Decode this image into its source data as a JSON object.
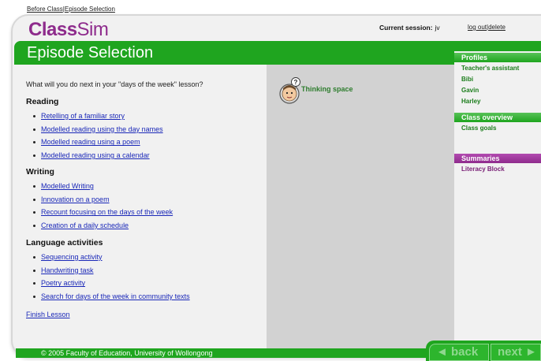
{
  "breadcrumb": {
    "item1": "Before Class",
    "separator": "|",
    "item2": "Episode Selection"
  },
  "app": {
    "logo_bold": "Class",
    "logo_light": "Sim"
  },
  "session": {
    "label": "Current session:",
    "value": "jv"
  },
  "account": {
    "logout": "log out",
    "separator": "|",
    "delete": "delete"
  },
  "page": {
    "title": "Episode Selection"
  },
  "main": {
    "prompt": "What will you do next in your \"days of the week\" lesson?",
    "sections": [
      {
        "heading": "Reading",
        "links": [
          "Retelling of a familiar story",
          "Modelled reading using the day names",
          "Modelled reading using a poem",
          "Modelled reading using a calendar"
        ]
      },
      {
        "heading": "Writing",
        "links": [
          "Modelled Writing",
          "Innovation on a poem",
          "Recount focusing on the days of the week",
          "Creation of a daily schedule"
        ]
      },
      {
        "heading": "Language activities",
        "links": [
          "Sequencing activity",
          "Handwriting task",
          "Poetry activity",
          "Search for days of the week in community texts"
        ]
      }
    ],
    "finish": "Finish Lesson"
  },
  "thinking": {
    "label": "Thinking space",
    "icon": "thinking-face-icon"
  },
  "sidebar": {
    "profiles_heading": "Profiles",
    "profiles": [
      "Teacher's assistant",
      "Bibi",
      "Gavin",
      "Harley"
    ],
    "overview_heading": "Class overview",
    "overview_items": [
      "Class goals"
    ],
    "summaries_heading": "Summaries",
    "summaries_items": [
      "Literacy Block"
    ]
  },
  "footer": {
    "copyright": "© 2005 Faculty of Education, University of Wollongong"
  },
  "nav": {
    "back": "◄ back",
    "next": "next ►"
  },
  "colors": {
    "brand_purple": "#8e2b8c",
    "brand_green": "#1fa51f",
    "link_blue": "#1a28b8",
    "panel_gray": "#d2d2d2"
  }
}
